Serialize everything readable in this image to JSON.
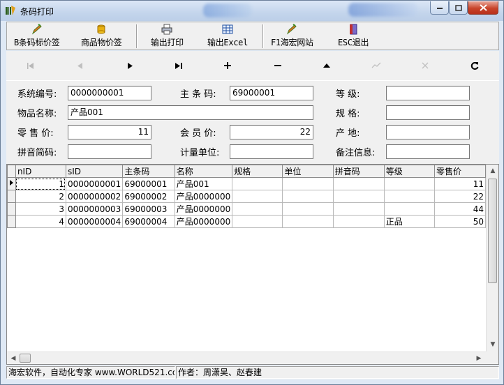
{
  "window": {
    "title": "条码打印"
  },
  "toolbar": {
    "buttons": [
      {
        "label": "B条码标价签",
        "icon": "pencil-icon"
      },
      {
        "label": "商品物价签",
        "icon": "coins-icon"
      },
      {
        "label": "输出打印",
        "icon": "printer-icon"
      },
      {
        "label": "输出Excel",
        "icon": "grid-icon"
      },
      {
        "label": "F1海宏网站",
        "icon": "pencil-icon"
      },
      {
        "label": "ESC退出",
        "icon": "exit-door-icon"
      }
    ]
  },
  "nav": {
    "buttons": [
      {
        "name": "first",
        "glyph": "⏮"
      },
      {
        "name": "prior",
        "glyph": "◀"
      },
      {
        "name": "next",
        "glyph": "▶"
      },
      {
        "name": "last",
        "glyph": "⏭"
      },
      {
        "name": "insert",
        "glyph": "+"
      },
      {
        "name": "delete",
        "glyph": "−"
      },
      {
        "name": "edit",
        "glyph": "▲"
      },
      {
        "name": "post",
        "glyph": "✓"
      },
      {
        "name": "cancel",
        "glyph": "✕"
      },
      {
        "name": "refresh",
        "glyph": "↻"
      }
    ]
  },
  "form": {
    "system_id": {
      "label": "系统编号:",
      "value": "0000000001"
    },
    "main_barcode": {
      "label": "主 条 码:",
      "value": "69000001"
    },
    "grade": {
      "label": "等    级:",
      "value": ""
    },
    "item_name": {
      "label": "物品名称:",
      "value": "产品001"
    },
    "spec": {
      "label": "规    格:",
      "value": ""
    },
    "retail_price": {
      "label": "零 售 价:",
      "value": "11"
    },
    "member_price": {
      "label": "会 员 价:",
      "value": "22"
    },
    "origin": {
      "label": "产    地:",
      "value": ""
    },
    "pinyin": {
      "label": "拼音简码:",
      "value": ""
    },
    "unit": {
      "label": "计量单位:",
      "value": ""
    },
    "remark": {
      "label": "备注信息:",
      "value": ""
    }
  },
  "grid": {
    "columns": [
      "nID",
      "sID",
      "主条码",
      "名称",
      "规格",
      "单位",
      "拼音码",
      "等级",
      "零售价"
    ],
    "rows": [
      [
        "1",
        "0000000001",
        "69000001",
        "产品001",
        "",
        "",
        "",
        "",
        "11"
      ],
      [
        "2",
        "0000000002",
        "69000002",
        "产品0000000",
        "",
        "",
        "",
        "",
        "22"
      ],
      [
        "3",
        "0000000003",
        "69000003",
        "产品0000000",
        "",
        "",
        "",
        "",
        "44"
      ],
      [
        "4",
        "0000000004",
        "69000004",
        "产品0000000",
        "",
        "",
        "",
        "正品",
        "50"
      ]
    ]
  },
  "status": {
    "left": "海宏软件，自动化专家 www.WORLD521.co",
    "right": "作者：周潇昊、赵春建"
  }
}
